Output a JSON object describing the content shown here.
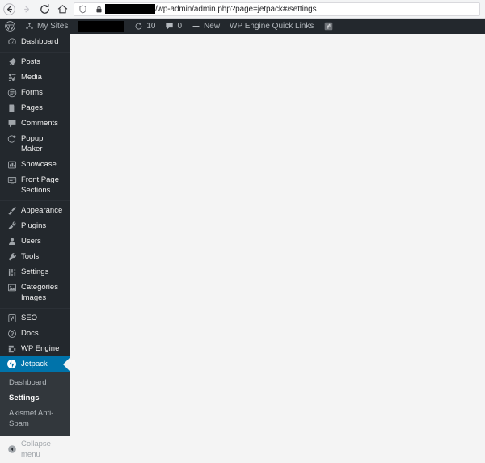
{
  "browser": {
    "back_icon": "back-arrow-icon",
    "forward_icon": "forward-arrow-icon",
    "reload_icon": "reload-icon",
    "home_icon": "home-icon",
    "shield_icon": "shield-icon",
    "lock_icon": "lock-icon",
    "url_redacted": true,
    "url_path": "/wp-admin/admin.php?page=jetpack#/settings"
  },
  "adminbar": {
    "wp_logo": "wordpress-logo-icon",
    "my_sites_icon": "network-icon",
    "my_sites_label": "My Sites",
    "site_name_redacted": true,
    "updates_icon": "updates-icon",
    "updates_count": "10",
    "comments_icon": "comment-bubble-icon",
    "comments_count": "0",
    "new_icon": "plus-icon",
    "new_label": "New",
    "wpengine_label": "WP Engine Quick Links",
    "yoast_icon": "yoast-seo-icon"
  },
  "sidebar": {
    "groups": [
      {
        "items": [
          {
            "label": "Dashboard",
            "icon": "dashboard-icon",
            "slug": "dashboard"
          }
        ]
      },
      {
        "items": [
          {
            "label": "Posts",
            "icon": "pin-icon",
            "slug": "posts"
          },
          {
            "label": "Media",
            "icon": "media-icon",
            "slug": "media"
          },
          {
            "label": "Forms",
            "icon": "forms-icon",
            "slug": "forms"
          },
          {
            "label": "Pages",
            "icon": "pages-icon",
            "slug": "pages"
          },
          {
            "label": "Comments",
            "icon": "comment-bubble-icon",
            "slug": "comments"
          },
          {
            "label": "Popup Maker",
            "icon": "popup-maker-icon",
            "slug": "popup-maker"
          },
          {
            "label": "Showcase",
            "icon": "showcase-icon",
            "slug": "showcase"
          },
          {
            "label": "Front Page Sections",
            "icon": "front-page-sections-icon",
            "slug": "front-page-sections"
          }
        ]
      },
      {
        "items": [
          {
            "label": "Appearance",
            "icon": "paintbrush-icon",
            "slug": "appearance"
          },
          {
            "label": "Plugins",
            "icon": "plugins-icon",
            "slug": "plugins"
          },
          {
            "label": "Users",
            "icon": "users-icon",
            "slug": "users"
          },
          {
            "label": "Tools",
            "icon": "tools-icon",
            "slug": "tools"
          },
          {
            "label": "Settings",
            "icon": "settings-gear-icon",
            "slug": "settings"
          },
          {
            "label": "Categories Images",
            "icon": "categories-images-icon",
            "slug": "categories-images"
          }
        ]
      },
      {
        "items": [
          {
            "label": "SEO",
            "icon": "yoast-seo-icon",
            "slug": "seo"
          },
          {
            "label": "Docs",
            "icon": "question-mark-icon",
            "slug": "docs"
          },
          {
            "label": "WP Engine",
            "icon": "wp-engine-icon",
            "slug": "wp-engine"
          },
          {
            "label": "Jetpack",
            "icon": "jetpack-icon",
            "slug": "jetpack",
            "current": true
          }
        ]
      }
    ],
    "jetpack_submenu": [
      {
        "label": "Dashboard",
        "slug": "jetpack-dashboard"
      },
      {
        "label": "Settings",
        "slug": "jetpack-settings",
        "current": true
      },
      {
        "label": "Akismet Anti-Spam",
        "slug": "akismet-anti-spam"
      }
    ],
    "collapse": {
      "label": "Collapse menu",
      "icon": "collapse-arrow-icon"
    }
  },
  "colors": {
    "admin_dark": "#23282d",
    "submenu_bg": "#32373c",
    "accent_blue": "#0073aa",
    "content_bg": "#f4f4f4"
  },
  "main": {
    "content": ""
  }
}
